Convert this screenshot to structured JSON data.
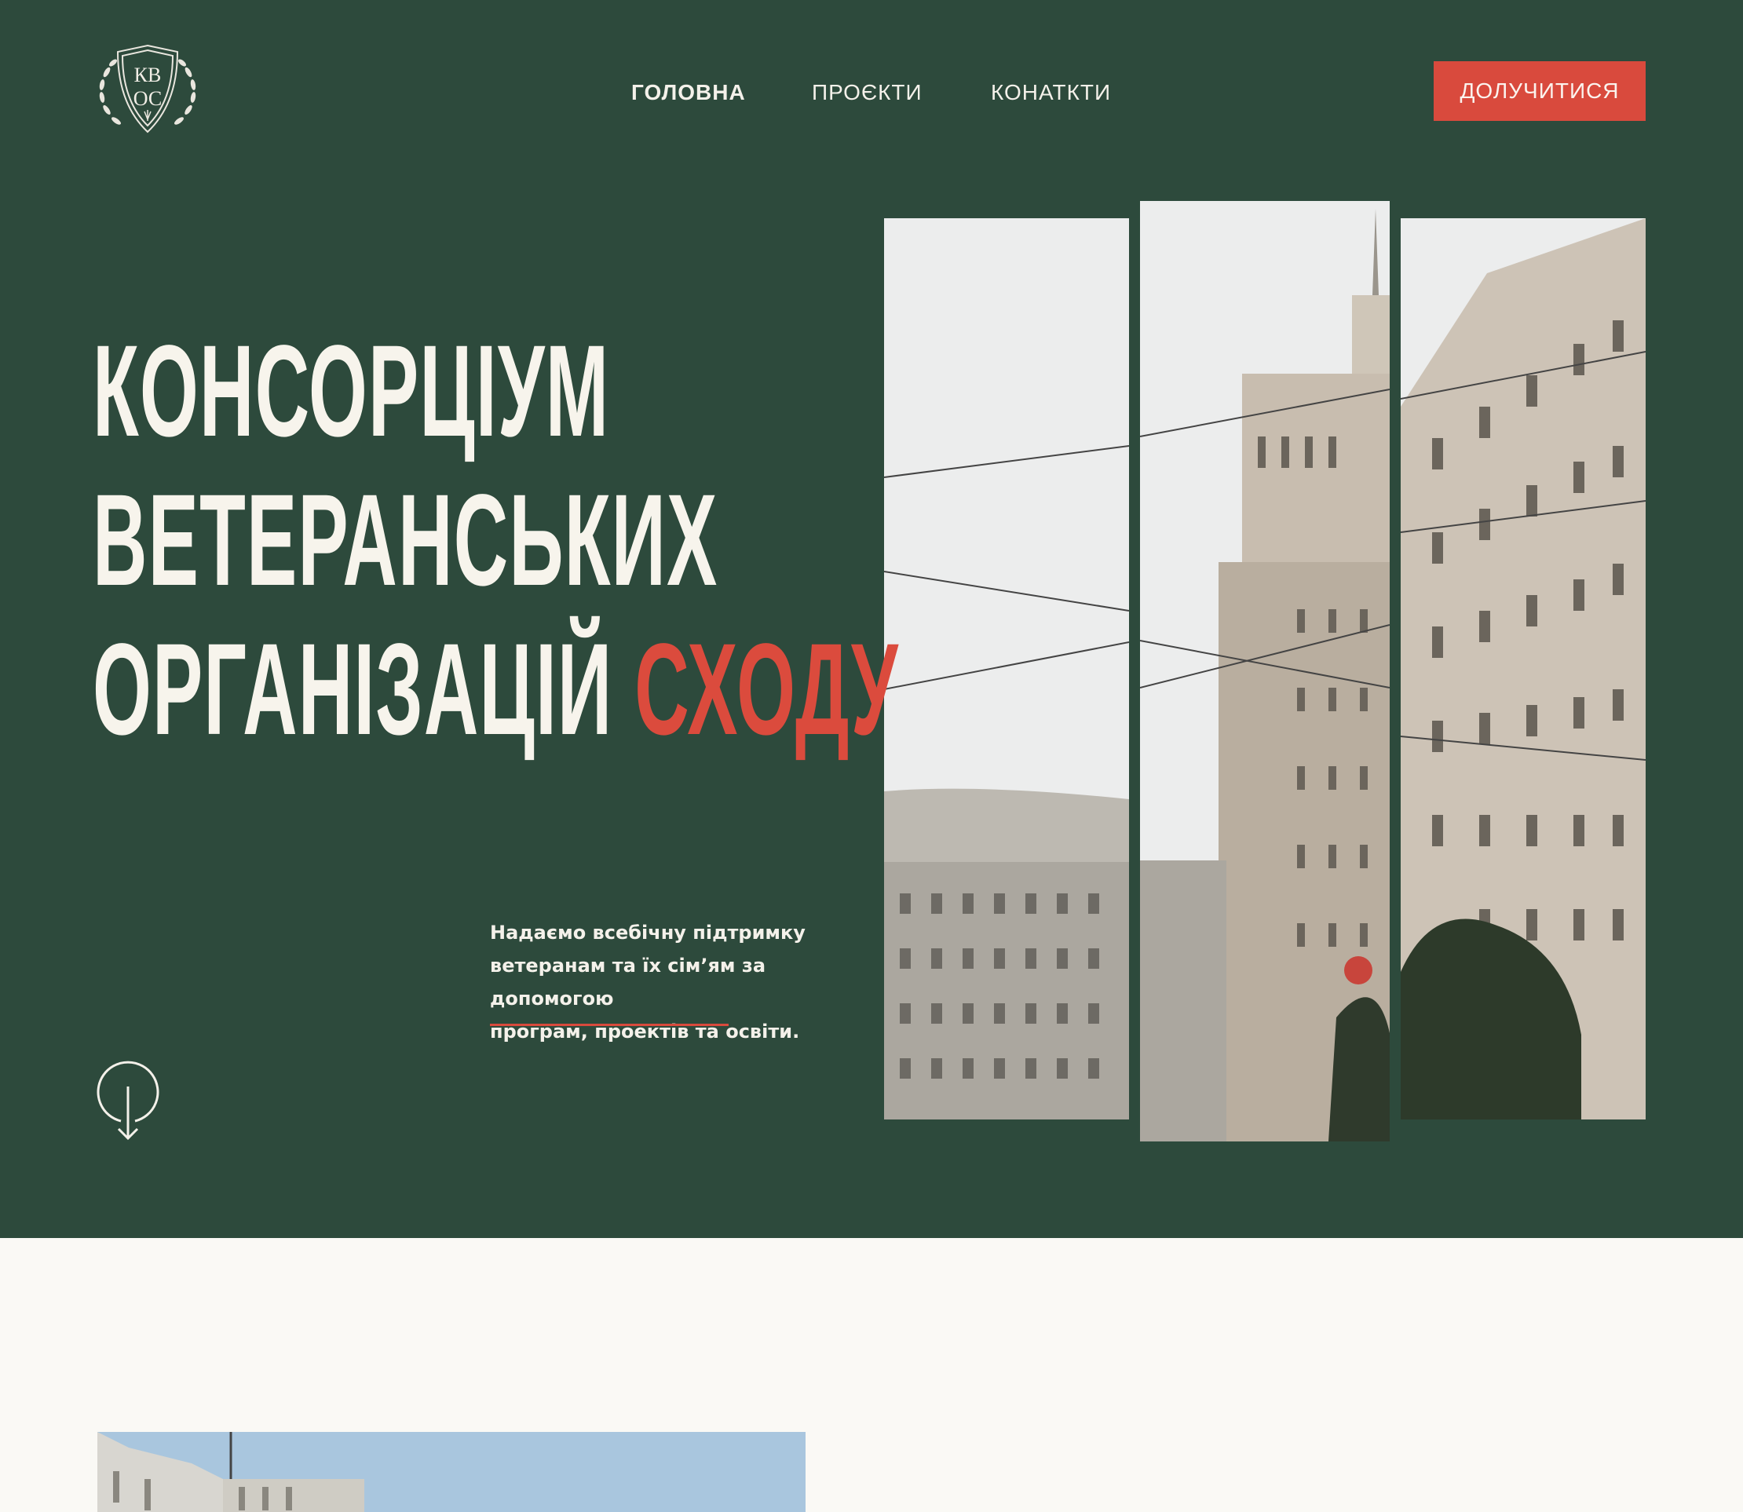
{
  "logo": {
    "line1": "КВ",
    "line2": "ОС"
  },
  "nav": {
    "items": [
      {
        "label": "ГОЛОВНА",
        "active": true
      },
      {
        "label": "ПРОЄКТИ",
        "active": false
      },
      {
        "label": "КОНАТКТИ",
        "active": false
      }
    ],
    "cta_label": "ДОЛУЧИТИСЯ"
  },
  "hero": {
    "title_line1": "КОНСОРЦІУМ",
    "title_line2": "ВЕТЕРАНСЬКИХ",
    "title_line3_white": "ОРГАНІЗАЦІЙ",
    "title_line3_accent": "СХОДУ",
    "subtitle_line1": "Надаємо всебічну підтримку",
    "subtitle_line2": "ветеранам та їх сім’ям за допомогою",
    "subtitle_line3": "програм, проектів та освіти.",
    "scroll_icon": "arrow-down-circle-icon"
  },
  "colors": {
    "hero_bg": "#2d4a3c",
    "accent": "#db4b3d",
    "text_light": "#f7f4ec",
    "page_bg": "#faf9f5"
  }
}
